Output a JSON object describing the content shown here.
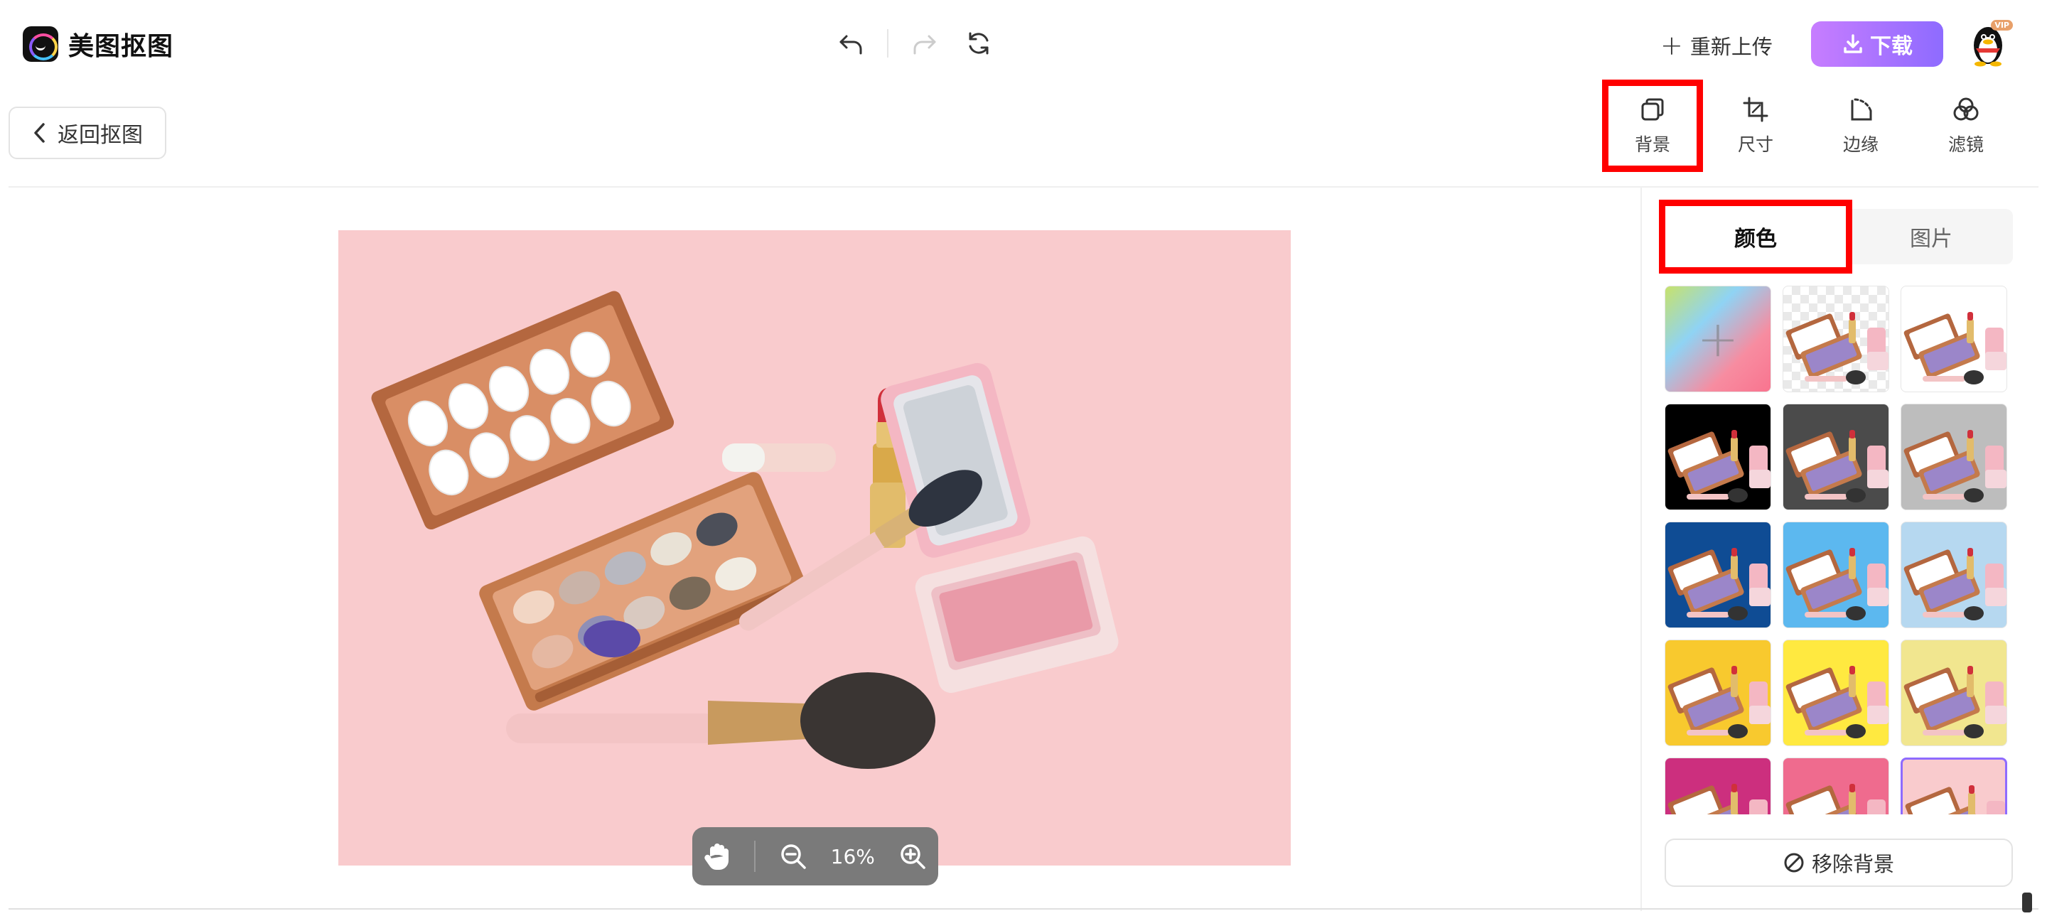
{
  "app": {
    "name": "美图抠图"
  },
  "header": {
    "reupload_label": "重新上传",
    "download_label": "下载",
    "vip_badge": "VIP"
  },
  "nav": {
    "back_label": "返回抠图"
  },
  "tools": [
    {
      "label": "背景",
      "icon": "background-layers-icon",
      "active": true
    },
    {
      "label": "尺寸",
      "icon": "crop-icon",
      "active": false
    },
    {
      "label": "边缘",
      "icon": "edge-icon",
      "active": false
    },
    {
      "label": "滤镜",
      "icon": "filter-circles-icon",
      "active": false
    }
  ],
  "panel": {
    "tabs": [
      {
        "label": "颜色",
        "active": true
      },
      {
        "label": "图片",
        "active": false
      }
    ],
    "remove_bg_label": "移除背景",
    "swatches": [
      {
        "bg": "gradient",
        "kind": "custom-color"
      },
      {
        "bg": "transparent"
      },
      {
        "bg": "#ffffff"
      },
      {
        "bg": "#000000"
      },
      {
        "bg": "#4b4b4b"
      },
      {
        "bg": "#bdbdbd"
      },
      {
        "bg": "#0f4c94"
      },
      {
        "bg": "#5cb8ef"
      },
      {
        "bg": "#b6d8f0"
      },
      {
        "bg": "#f8c92e"
      },
      {
        "bg": "#ffe940"
      },
      {
        "bg": "#f1e68f"
      },
      {
        "bg": "#cc2f7e"
      },
      {
        "bg": "#ef6b8e"
      },
      {
        "bg": "#f9cbcd",
        "selected": true
      }
    ]
  },
  "canvas": {
    "background": "#f9cbcd",
    "zoom": "16%"
  },
  "colors": {
    "accent": "#8e6bff",
    "highlight": "#ff0000"
  }
}
